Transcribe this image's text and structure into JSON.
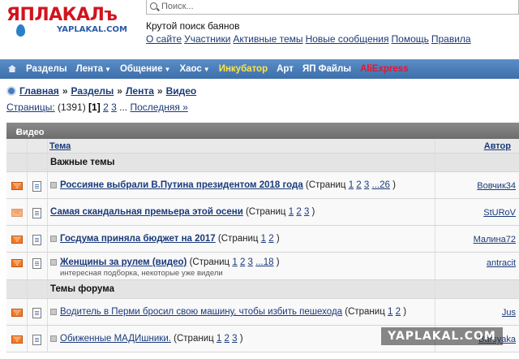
{
  "logo": {
    "main": "ЯПЛАКАЛъ",
    "sub": "YAPLAKAL.COM"
  },
  "search": {
    "placeholder": "Поиск..."
  },
  "tagline": "Крутой поиск баянов",
  "toplinks": [
    "О сайте",
    "Участники",
    "Активные темы",
    "Новые сообщения",
    "Помощь",
    "Правила"
  ],
  "nav": [
    {
      "label": "Разделы",
      "caret": false,
      "style": ""
    },
    {
      "label": "Лента",
      "caret": true,
      "style": ""
    },
    {
      "label": "Общение",
      "caret": true,
      "style": ""
    },
    {
      "label": "Хаос",
      "caret": true,
      "style": ""
    },
    {
      "label": "Инкубатор",
      "caret": false,
      "style": "yellow"
    },
    {
      "label": "Арт",
      "caret": false,
      "style": ""
    },
    {
      "label": "ЯП Файлы",
      "caret": false,
      "style": ""
    },
    {
      "label": "AliExpress",
      "caret": false,
      "style": "red"
    }
  ],
  "breadcrumbs": [
    "Главная",
    "Разделы",
    "Лента",
    "Видео"
  ],
  "pagination": {
    "prefix": "Страницы:",
    "count": "(1391)",
    "current": "[1]",
    "pages": [
      "2",
      "3"
    ],
    "ellipsis": "...",
    "last": "Последняя »"
  },
  "section": {
    "title": "Видео"
  },
  "columns": {
    "topic": "Тема",
    "author": "Автор"
  },
  "groups": [
    {
      "label": "Важные темы",
      "topics": [
        {
          "title": "Россияне выбрали В.Путина президентом 2018 года",
          "bold": true,
          "pages": [
            "1",
            "2",
            "3",
            "...26"
          ],
          "author": "Вовчик34",
          "desc": "",
          "dim": false,
          "marker": true
        },
        {
          "title": "Самая скандальная премьера этой осени",
          "bold": true,
          "pages": [
            "1",
            "2",
            "3"
          ],
          "author": "StURoV",
          "desc": "",
          "dim": true,
          "marker": false
        },
        {
          "title": "Госдума приняла бюджет на 2017",
          "bold": true,
          "pages": [
            "1",
            "2"
          ],
          "author": "Малина72",
          "desc": "",
          "dim": false,
          "marker": true
        },
        {
          "title": "Женщины за рулем (видео)",
          "bold": true,
          "pages": [
            "1",
            "2",
            "3",
            "...18"
          ],
          "author": "antracit",
          "desc": "интересная подборка, некоторые уже видели",
          "dim": false,
          "marker": true
        }
      ]
    },
    {
      "label": "Темы форума",
      "topics": [
        {
          "title": "Водитель в Перми бросил свою машину, чтобы избить пешехода",
          "bold": false,
          "pages": [
            "1",
            "2"
          ],
          "author": "Jus",
          "desc": "",
          "dim": false,
          "marker": true
        },
        {
          "title": "Обиженные МАДИшники.",
          "bold": false,
          "pages": [
            "1",
            "2",
            "3"
          ],
          "author": "Barsyaka",
          "desc": "",
          "dim": false,
          "marker": true
        }
      ]
    }
  ],
  "strings": {
    "pages_prefix": "(Страниц",
    "pages_suffix": ")"
  },
  "watermark": "YAPLAKAL.COM",
  "colors": {
    "nav_bg": "#4a7db8",
    "link": "#1a3a7a",
    "incubator": "#ffe545",
    "aliexpress": "#e8142c",
    "highlight": "#fff200"
  }
}
